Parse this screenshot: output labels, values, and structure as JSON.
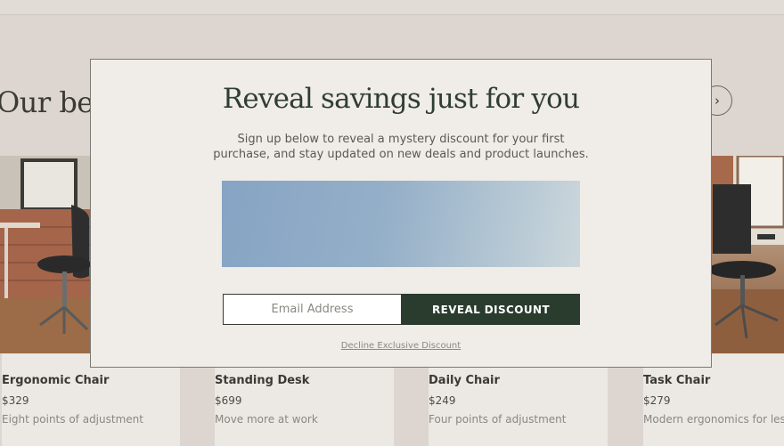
{
  "background": {
    "section_title": "Our best",
    "next_arrow_icon": "chevron-right-icon",
    "products": [
      {
        "name": "Ergonomic Chair",
        "price": "$329",
        "desc": "Eight points of adjustment"
      },
      {
        "name": "Standing Desk",
        "price": "$699",
        "desc": "Move more at work"
      },
      {
        "name": "Daily Chair",
        "price": "$249",
        "desc": "Four points of adjustment"
      },
      {
        "name": "Task Chair",
        "price": "$279",
        "desc": "Modern ergonomics for less"
      }
    ]
  },
  "modal": {
    "title": "Reveal savings just for you",
    "subtitle_line1": "Sign up below to reveal a mystery discount for your first",
    "subtitle_line2": "purchase, and stay updated on new deals and product launches.",
    "email_placeholder": "Email Address",
    "email_value": "",
    "submit_label": "REVEAL DISCOUNT",
    "decline_label": "Decline Exclusive Discount"
  },
  "colors": {
    "accent_dark_green": "#2a3c2e",
    "modal_bg": "#f0ece7",
    "page_bg": "#ddd6d0"
  }
}
